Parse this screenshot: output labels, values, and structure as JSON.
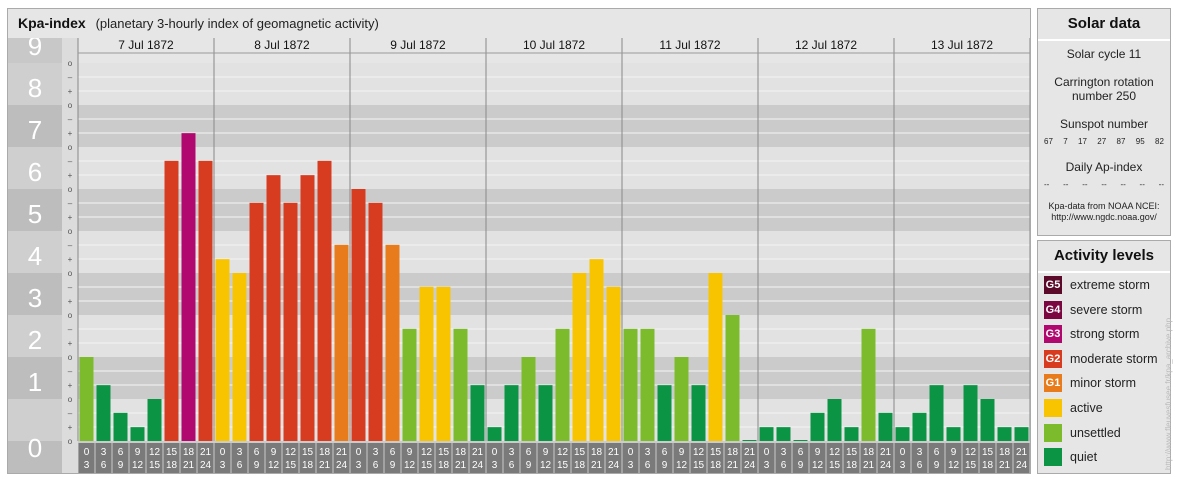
{
  "header": {
    "title": "Kpa-index",
    "subtitle": "(planetary 3-hourly index of geomagnetic activity)"
  },
  "chart_data": {
    "type": "bar",
    "y_range": [
      0,
      9
    ],
    "y_ticks": [
      "0",
      "1",
      "2",
      "3",
      "4",
      "5",
      "6",
      "7",
      "8",
      "9"
    ],
    "y_minor_labels": [
      "o",
      "–",
      "+"
    ],
    "days": [
      "7 Jul 1872",
      "8 Jul 1872",
      "9 Jul 1872",
      "10 Jul 1872",
      "11 Jul 1872",
      "12 Jul 1872",
      "13 Jul 1872"
    ],
    "interval_start": [
      "0",
      "3",
      "6",
      "9",
      "12",
      "15",
      "18",
      "21"
    ],
    "interval_end": [
      "3",
      "6",
      "9",
      "12",
      "15",
      "18",
      "21",
      "24"
    ],
    "values": [
      [
        2.0,
        1.33,
        0.67,
        0.33,
        1.0,
        6.67,
        7.33,
        6.67
      ],
      [
        4.33,
        4.0,
        5.67,
        6.33,
        5.67,
        6.33,
        6.67,
        4.67
      ],
      [
        6.0,
        5.67,
        4.67,
        2.67,
        3.67,
        3.67,
        2.67,
        1.33
      ],
      [
        0.33,
        1.33,
        2.0,
        1.33,
        2.67,
        4.0,
        4.33,
        3.67
      ],
      [
        2.67,
        2.67,
        1.33,
        2.0,
        1.33,
        4.0,
        3.0,
        0.0
      ],
      [
        0.33,
        0.33,
        0.0,
        0.67,
        1.0,
        0.33,
        2.67,
        0.67
      ],
      [
        0.33,
        0.67,
        1.33,
        0.33,
        1.33,
        1.0,
        0.33,
        0.33
      ]
    ],
    "gridlines": true
  },
  "activity_levels": [
    {
      "badge": "G5",
      "label": "extreme storm",
      "color": "#5c0a2a",
      "min": 9
    },
    {
      "badge": "G4",
      "label": "severe storm",
      "color": "#7b0640",
      "min": 8
    },
    {
      "badge": "G3",
      "label": "strong storm",
      "color": "#b0086e",
      "min": 7
    },
    {
      "badge": "G2",
      "label": "moderate storm",
      "color": "#d83c20",
      "min": 5.5
    },
    {
      "badge": "G1",
      "label": "minor storm",
      "color": "#e87c1c",
      "min": 4.67
    },
    {
      "badge": "",
      "label": "active",
      "color": "#f8c400",
      "min": 3.67
    },
    {
      "badge": "",
      "label": "unsettled",
      "color": "#7cbc2c",
      "min": 2
    },
    {
      "badge": "",
      "label": "quiet",
      "color": "#0a9444",
      "min": 0
    }
  ],
  "solar": {
    "title": "Solar data",
    "cycle": "Solar cycle 11",
    "carrington_line1": "Carrington rotation",
    "carrington_line2": "number 250",
    "sunspot_label": "Sunspot number",
    "sunspot_values": [
      "67",
      "7",
      "17",
      "27",
      "87",
      "95",
      "82"
    ],
    "ap_label": "Daily Ap-index",
    "ap_values": [
      "--",
      "--",
      "--",
      "--",
      "--",
      "--",
      "--"
    ],
    "credit_line1": "Kpa-data from NOAA NCEI:",
    "credit_line2": "http://www.ngdc.noaa.gov/"
  },
  "levels_panel": {
    "title": "Activity levels"
  },
  "watermark": "http://www.fleuvesfusee.fr/kpa_archive.php"
}
